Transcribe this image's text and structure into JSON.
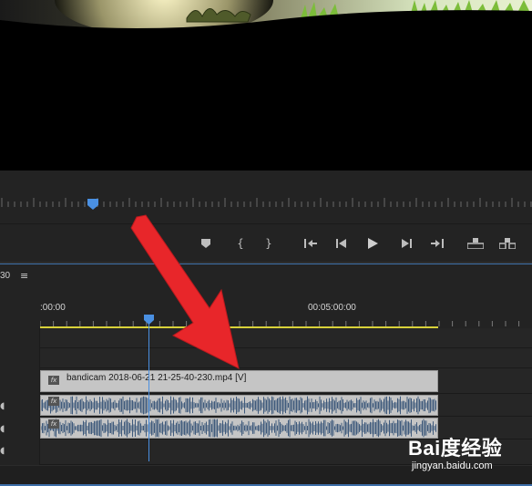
{
  "timeline": {
    "timecode_partial": "30",
    "menu_icon": "hamburger-menu-icon",
    "ruler_labels": [
      ":00:00",
      "00:05:00:00"
    ],
    "clip_video_label": "bandicam 2018-06-21 21-25-40-230.mp4 [V]",
    "clip_fx_badge": "fx"
  },
  "transport": {
    "buttons": [
      {
        "name": "add-marker-button",
        "icon": "marker-icon"
      },
      {
        "name": "mark-in-button",
        "icon": "bracket-in-icon",
        "glyph": "{"
      },
      {
        "name": "mark-out-button",
        "icon": "bracket-out-icon",
        "glyph": "}"
      },
      {
        "name": "go-to-in-button",
        "icon": "go-to-in-icon"
      },
      {
        "name": "step-back-button",
        "icon": "step-back-icon"
      },
      {
        "name": "play-button",
        "icon": "play-icon"
      },
      {
        "name": "step-forward-button",
        "icon": "step-forward-icon"
      },
      {
        "name": "go-to-out-button",
        "icon": "go-to-out-icon"
      },
      {
        "name": "lift-button",
        "icon": "lift-icon"
      },
      {
        "name": "extract-button",
        "icon": "extract-icon"
      }
    ]
  },
  "watermark": {
    "logo": "Bai度经验",
    "url": "jingyan.baidu.com"
  },
  "colors": {
    "accent_blue": "#4a90e2",
    "work_area_yellow": "#d8d13a",
    "annotation_red": "#e8262a",
    "clip_grey": "#c5c5c5"
  }
}
